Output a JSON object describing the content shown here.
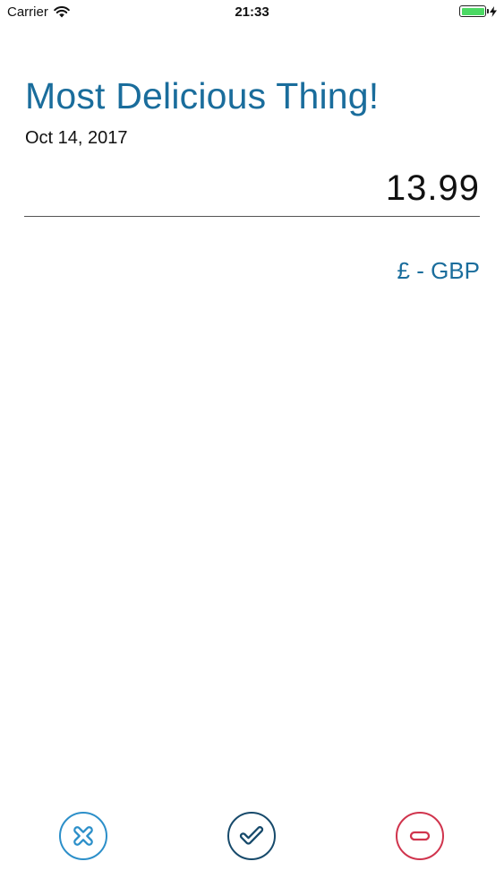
{
  "status_bar": {
    "carrier": "Carrier",
    "time": "21:33",
    "battery_color": "#4cd964"
  },
  "entry": {
    "title": "Most Delicious Thing!",
    "date": "Oct 14, 2017",
    "amount": "13.99",
    "currency": "£ - GBP"
  },
  "actions": {
    "cancel_icon": "x-circle-icon",
    "confirm_icon": "check-circle-icon",
    "delete_icon": "minus-circle-icon"
  },
  "colors": {
    "accent": "#1a6d9c",
    "cancel": "#2c8fc9",
    "confirm": "#174a6b",
    "delete": "#d0344d"
  }
}
